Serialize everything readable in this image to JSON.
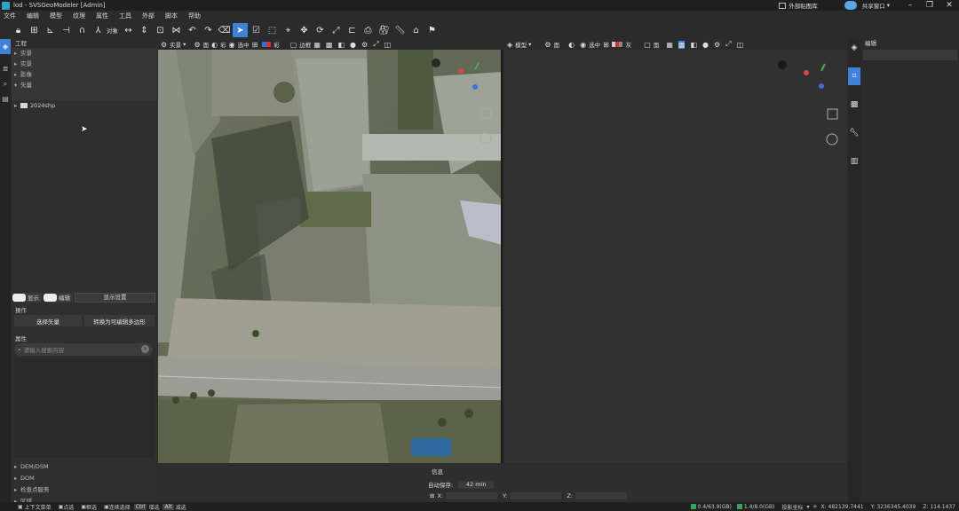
{
  "titlebar": {
    "title": "lod - SVSGeoModeler [Admin]",
    "library_label": "外部贴图库",
    "share_label": "共享窗口"
  },
  "menu": [
    "文件",
    "编辑",
    "模型",
    "纹理",
    "属性",
    "工具",
    "外部",
    "脚本",
    "帮助"
  ],
  "toolbar": {
    "object_label": "对象"
  },
  "viewbar_left": {
    "mode": "实景",
    "wire": "面",
    "color": "彩",
    "display": "选中",
    "border": "边框"
  },
  "viewbar_right": {
    "mode": "模型",
    "wire": "面",
    "display": "选中",
    "gray": "灰",
    "face": "面"
  },
  "left_panel": {
    "title": "工程",
    "tree": [
      "实景",
      "实景",
      "影像",
      "矢量"
    ],
    "folder": "2024shp",
    "toggle_show": "显示",
    "toggle_edit": "编辑",
    "display_settings": "显示设置",
    "ops_title": "操作",
    "btn_select_vector": "选择矢量",
    "btn_convert": "转换为可编辑多边形",
    "props_title": "属性",
    "search_placeholder": "请输入搜索内容",
    "bottom_tree": [
      "DEM/DSM",
      "DOM",
      "检查点服务",
      "区域"
    ]
  },
  "right_panel": {
    "title": "编辑"
  },
  "info": {
    "title": "信息",
    "autosave_label": "自动保存:",
    "autosave_value": "42 min",
    "x": "X:",
    "y": "Y:",
    "z": "Z:"
  },
  "status": {
    "context_menu": "上下文菜单",
    "pick": "点选",
    "box": "框选",
    "continuous": "连续选择",
    "ctrl": "Ctrl",
    "add": "增选",
    "alt": "Alt",
    "subtract": "减选",
    "mem1": "0.4/63.9(GB)",
    "mem2": "1.4/8.0(GB)",
    "proj": "投影坐标",
    "xcoord": "X: 482139.7441",
    "ycoord": "Y: 3236345.4039",
    "zcoord": "Z: 114.1437"
  },
  "colors": {
    "accent": "#3d82d8",
    "bg": "#2b2b2b",
    "panel": "#2f2f2f"
  }
}
